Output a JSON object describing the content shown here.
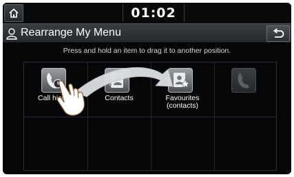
{
  "status_bar": {
    "home_icon": "home-icon",
    "time": "01:02"
  },
  "title_bar": {
    "user_icon": "user-icon",
    "title": "Rearrange My Menu",
    "back_icon": "back-arrow-icon"
  },
  "instruction": "Press and hold an item to drag it to another position.",
  "menu_items": [
    {
      "label": "Call history",
      "icon": "call-history-icon"
    },
    {
      "label": "Contacts",
      "icon": "contacts-icon"
    },
    {
      "label": "Favourites\n(contacts)",
      "icon": "favourite-contacts-icon"
    },
    {
      "label": "",
      "icon": "phone-icon"
    }
  ],
  "overlay": {
    "hand_icon": "hand-pointer-icon",
    "drag_arrow": "drag-arrow"
  },
  "colors": {
    "background": "#050607",
    "title_bar": "#33373c",
    "text": "#ffffff",
    "arrow": "#d9dcdf"
  }
}
